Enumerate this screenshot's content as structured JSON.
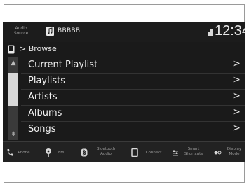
{
  "header": {
    "audio_source_label": "Audio Source",
    "device_name": "BBBBB",
    "clock": "12:34"
  },
  "breadcrumb": {
    "label": "> Browse"
  },
  "list": {
    "items": [
      {
        "label": "Current Playlist"
      },
      {
        "label": "Playlists"
      },
      {
        "label": "Artists"
      },
      {
        "label": "Albums"
      },
      {
        "label": "Songs"
      }
    ]
  },
  "bottom_bar": {
    "items": [
      {
        "label": "Phone",
        "icon": "phone-handset-icon"
      },
      {
        "label": "FM",
        "icon": "antenna-icon"
      },
      {
        "label": "Bluetooth Audio",
        "icon": "bluetooth-icon"
      },
      {
        "label": "Connect",
        "icon": "device-icon"
      },
      {
        "label": "Smart Shortcuts",
        "icon": "shortcuts-icon"
      },
      {
        "label": "Display Mode",
        "icon": "display-mode-icon"
      }
    ]
  },
  "colors": {
    "screen_background": "#1a1a1a",
    "text": "#e8e8e8",
    "scroll_thumb": "#d8d8d8"
  }
}
